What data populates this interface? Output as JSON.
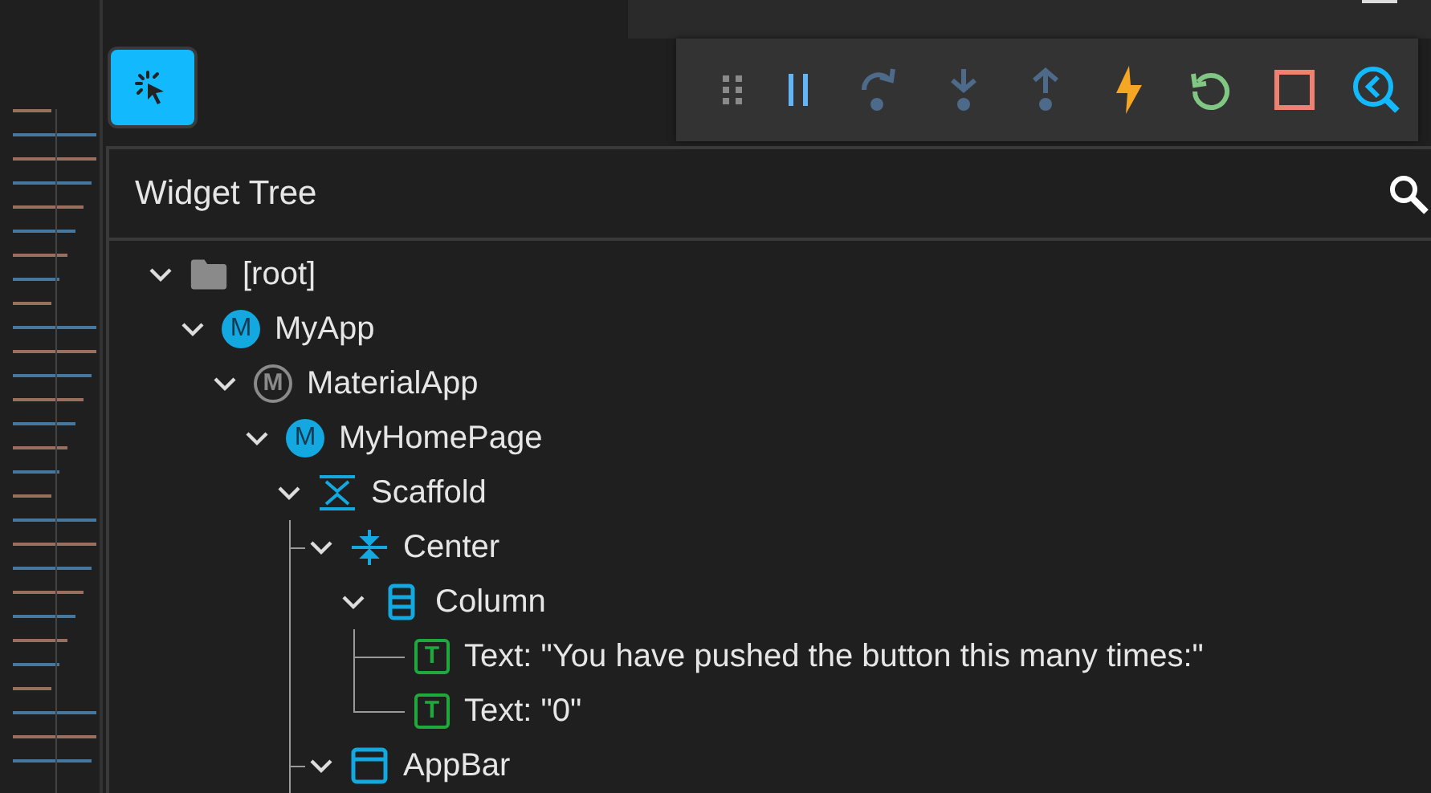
{
  "select_widget_button": {
    "selected": true
  },
  "debug_toolbar": [
    {
      "kind": "grip"
    },
    {
      "kind": "pause"
    },
    {
      "kind": "step-over"
    },
    {
      "kind": "step-into"
    },
    {
      "kind": "step-out"
    },
    {
      "kind": "hot-reload"
    },
    {
      "kind": "restart"
    },
    {
      "kind": "stop"
    },
    {
      "kind": "inspector"
    }
  ],
  "panel": {
    "title": "Widget Tree"
  },
  "tree": [
    {
      "label": "[root]",
      "kind": "folder",
      "expanded": true,
      "children": [
        {
          "label": "MyApp",
          "kind": "class",
          "badge": "M",
          "expanded": true,
          "children": [
            {
              "label": "MaterialApp",
              "kind": "material",
              "badge": "M",
              "expanded": true,
              "children": [
                {
                  "label": "MyHomePage",
                  "kind": "class",
                  "badge": "M",
                  "expanded": true,
                  "children": [
                    {
                      "label": "Scaffold",
                      "kind": "scaffold",
                      "expanded": true,
                      "children": [
                        {
                          "label": "Center",
                          "kind": "center",
                          "expanded": true,
                          "children": [
                            {
                              "label": "Column",
                              "kind": "column",
                              "expanded": true,
                              "children": [
                                {
                                  "label": "Text: \"You have pushed the button this many times:\"",
                                  "kind": "text",
                                  "badge": "T"
                                },
                                {
                                  "label": "Text: \"0\"",
                                  "kind": "text",
                                  "badge": "T"
                                }
                              ]
                            }
                          ]
                        },
                        {
                          "label": "AppBar",
                          "kind": "appbar",
                          "expanded": true
                        }
                      ]
                    }
                  ]
                }
              ]
            }
          ]
        }
      ]
    }
  ]
}
